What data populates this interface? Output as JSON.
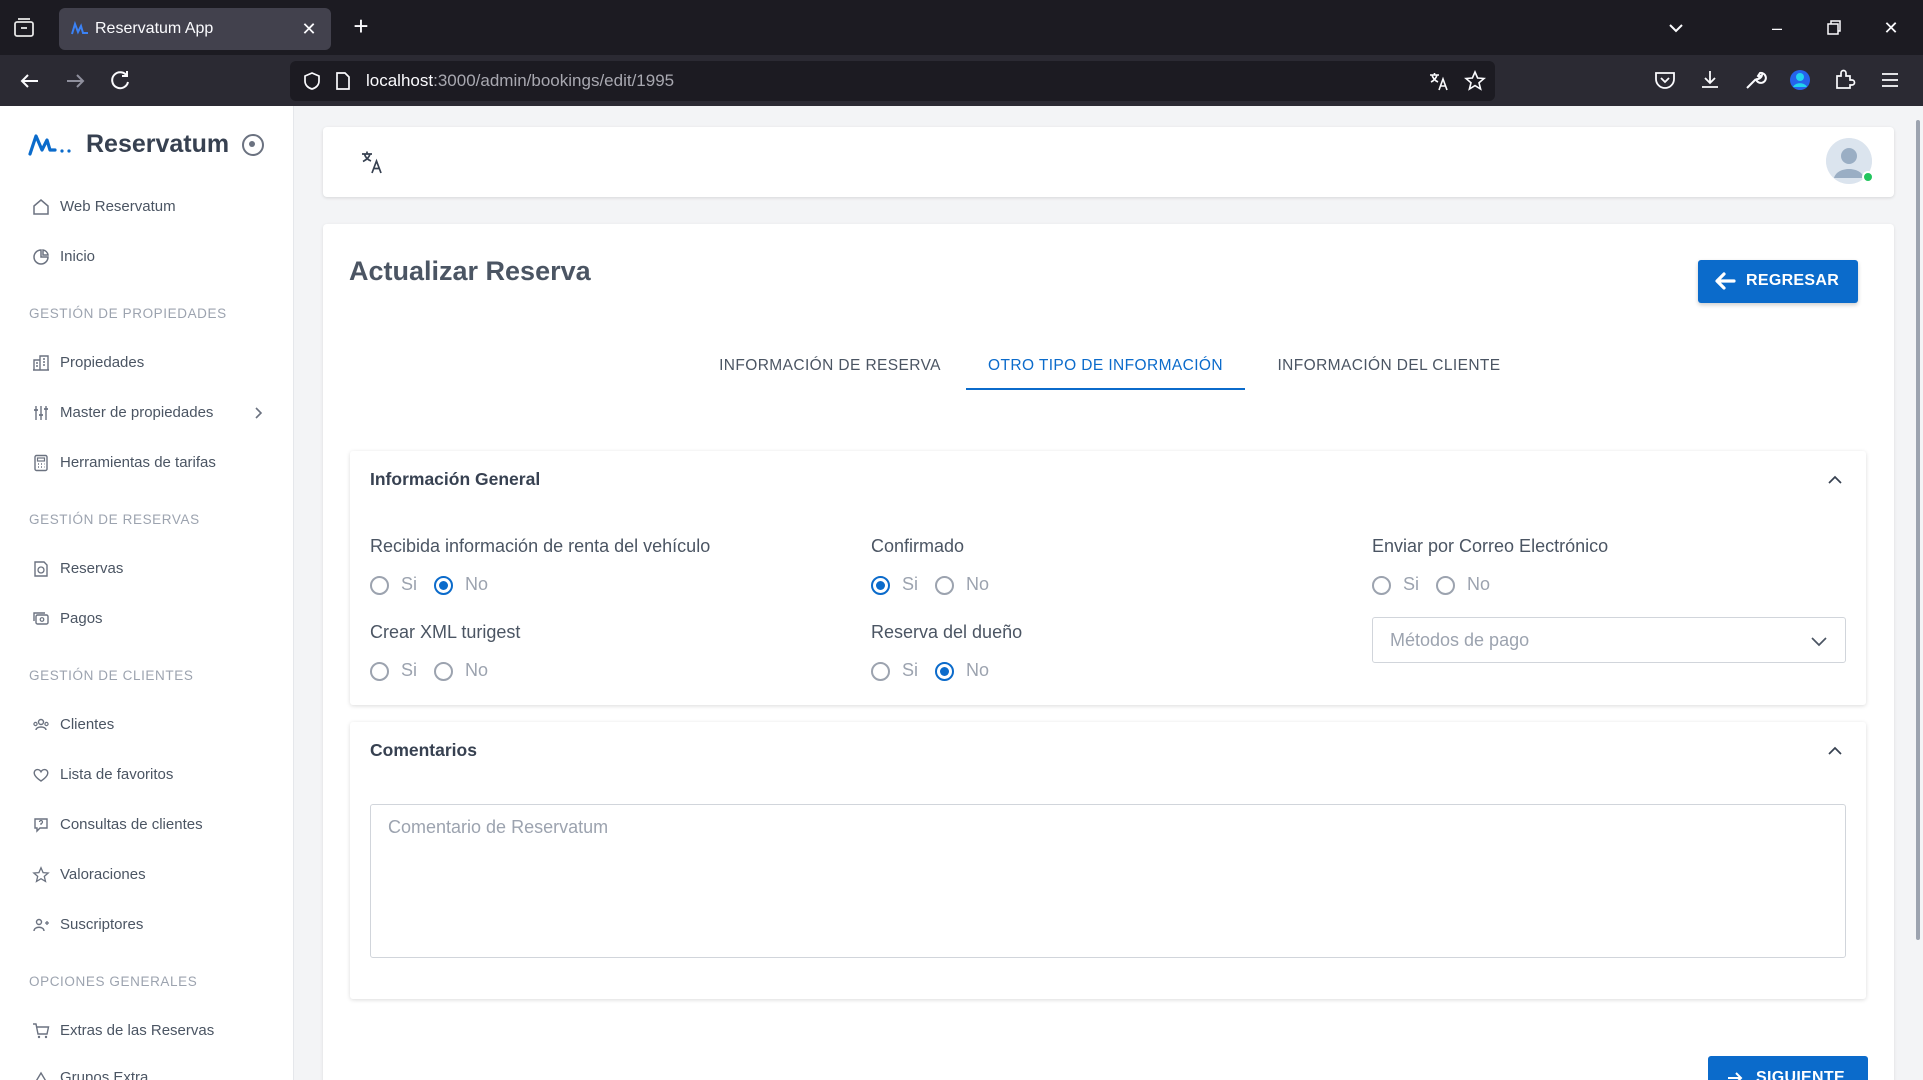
{
  "browser": {
    "tab_title": "Reservatum App",
    "url_host": "localhost",
    "url_rest": ":3000/admin/bookings/edit/1995"
  },
  "sidebar": {
    "brand": "Reservatum",
    "items_top": [
      {
        "label": "Web Reservatum",
        "icon": "home-icon"
      },
      {
        "label": "Inicio",
        "icon": "dashboard-icon"
      }
    ],
    "sections": [
      {
        "title": "GESTIÓN DE PROPIEDADES",
        "items": [
          {
            "label": "Propiedades",
            "icon": "buildings-icon"
          },
          {
            "label": "Master de propiedades",
            "icon": "sliders-icon",
            "has_submenu": true
          },
          {
            "label": "Herramientas de tarifas",
            "icon": "calculator-icon"
          }
        ]
      },
      {
        "title": "GESTIÓN DE RESERVAS",
        "items": [
          {
            "label": "Reservas",
            "icon": "bookings-icon"
          },
          {
            "label": "Pagos",
            "icon": "payments-icon"
          }
        ]
      },
      {
        "title": "GESTIÓN DE CLIENTES",
        "items": [
          {
            "label": "Clientes",
            "icon": "users-icon"
          },
          {
            "label": "Lista de favoritos",
            "icon": "heart-icon"
          },
          {
            "label": "Consultas de clientes",
            "icon": "chat-question-icon"
          },
          {
            "label": "Valoraciones",
            "icon": "star-icon"
          },
          {
            "label": "Suscriptores",
            "icon": "subscribers-icon"
          }
        ]
      },
      {
        "title": "OPCIONES GENERALES",
        "items": [
          {
            "label": "Extras de las Reservas",
            "icon": "cart-icon"
          },
          {
            "label": "Grupos Extra",
            "icon": "group-icon"
          }
        ]
      }
    ]
  },
  "main": {
    "title": "Actualizar Reserva",
    "back_label": "REGRESAR",
    "next_label": "SIGUIENTE",
    "tabs": [
      {
        "label": "INFORMACIÓN DE RESERVA",
        "active": false
      },
      {
        "label": "OTRO TIPO DE INFORMACIÓN",
        "active": true
      },
      {
        "label": "INFORMACIÓN DEL CLIENTE",
        "active": false
      }
    ],
    "general_panel": {
      "title": "Información General",
      "fields": {
        "vehicle_rental": {
          "label": "Recibida información de renta del vehículo",
          "yes": "Si",
          "no": "No",
          "value": "No"
        },
        "confirmed": {
          "label": "Confirmado",
          "yes": "Si",
          "no": "No",
          "value": "Si"
        },
        "send_email": {
          "label": "Enviar por Correo Electrónico",
          "yes": "Si",
          "no": "No",
          "value": null
        },
        "xml_turigest": {
          "label": "Crear XML turigest",
          "yes": "Si",
          "no": "No",
          "value": null
        },
        "owner_booking": {
          "label": "Reserva del dueño",
          "yes": "Si",
          "no": "No",
          "value": "No"
        }
      },
      "payment_methods_placeholder": "Métodos de pago"
    },
    "comments_panel": {
      "title": "Comentarios",
      "placeholder": "Comentario de Reservatum"
    }
  },
  "colors": {
    "primary": "#0b6bcb",
    "online": "#22c55e"
  }
}
